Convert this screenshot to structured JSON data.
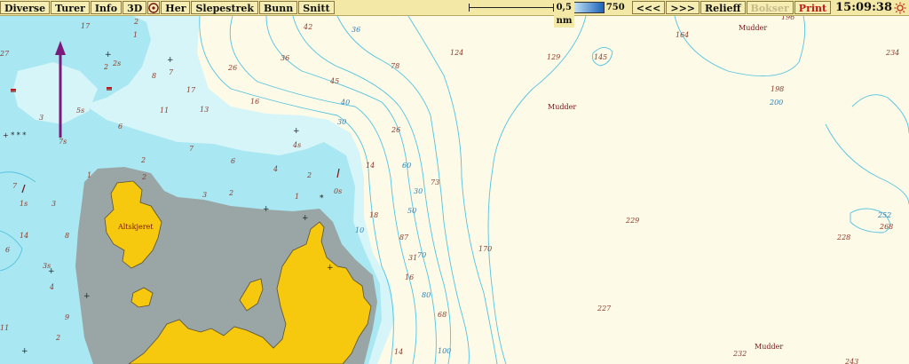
{
  "toolbar": {
    "menu": [
      "Diverse",
      "Turer",
      "Info",
      "3D"
    ],
    "buttons": [
      "Her",
      "Slepestrek",
      "Bunn",
      "Snitt"
    ],
    "scale_label": "0,5 nm",
    "depth_min": "0",
    "depth_max": "750",
    "nav_prev": "<<<",
    "nav_next": ">>>",
    "relief": "Relieff",
    "bokser": "Bokser",
    "print": "Print",
    "time": "15:09:38",
    "compass_icon": "compass-icon",
    "sun_icon": "sun-icon"
  },
  "map": {
    "place_names": [
      "Altskjeret",
      "Mudder",
      "Mudder",
      "Mudder"
    ],
    "depths": [
      "17",
      "2",
      "1",
      "27",
      "2",
      "2s",
      "8",
      "7",
      "3",
      "5s",
      "7s",
      "6",
      "17",
      "11",
      "13",
      "26",
      "36",
      "42",
      "36",
      "45",
      "16",
      "7",
      "1",
      "2",
      "4",
      "6",
      "4s",
      "2",
      "0s",
      "1",
      "2",
      "3",
      "2",
      "7",
      "14",
      "6",
      "8",
      "3s",
      "4",
      "9",
      "11",
      "2",
      "26",
      "14",
      "18",
      "30",
      "73",
      "87",
      "31",
      "16",
      "68",
      "14",
      "78",
      "124",
      "129",
      "145",
      "164",
      "196",
      "234",
      "198",
      "200",
      "170",
      "229",
      "227",
      "228",
      "252",
      "268",
      "232",
      "243",
      "40",
      "60",
      "80",
      "100",
      "50",
      "70",
      "30",
      "1s",
      "3",
      "10"
    ],
    "colors": {
      "deep": "#fdfae8",
      "shallow": "#d6f5f8",
      "very_shallow": "#a9e7f2",
      "land": "#f6c90e",
      "drying": "#9aa6a6",
      "contour": "#55c3df"
    },
    "icons": {
      "north_arrow": "north-arrow-icon",
      "rock": "rock-icon",
      "beacon": "beacon-icon"
    }
  }
}
